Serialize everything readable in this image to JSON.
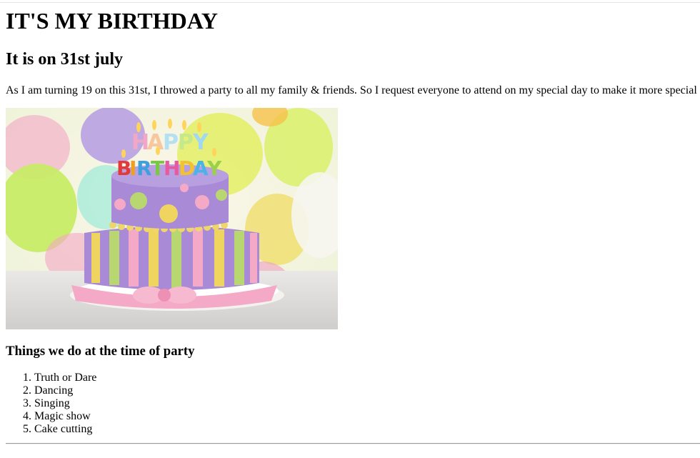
{
  "heading": "IT'S MY BIRTHDAY",
  "subheading": "It is on 31st july",
  "intro": "As I am turning 19 on this 31st, I throwed a party to all my family & friends. So I request everyone to attend on my special day to make it more special",
  "image": {
    "caption_line1": "HAPPY",
    "caption_line2": "BIRTHDAY",
    "colors": {
      "cake_purple": "#a98ad6",
      "ribbon_pink": "#f4a9c6",
      "stripe_yellow": "#f0d460",
      "stripe_green": "#b9d770",
      "plate": "#f4f2ef"
    }
  },
  "section_title": "Things we do at the time of party",
  "activities": [
    "Truth or Dare",
    "Dancing",
    "Singing",
    "Magic show",
    "Cake cutting"
  ]
}
